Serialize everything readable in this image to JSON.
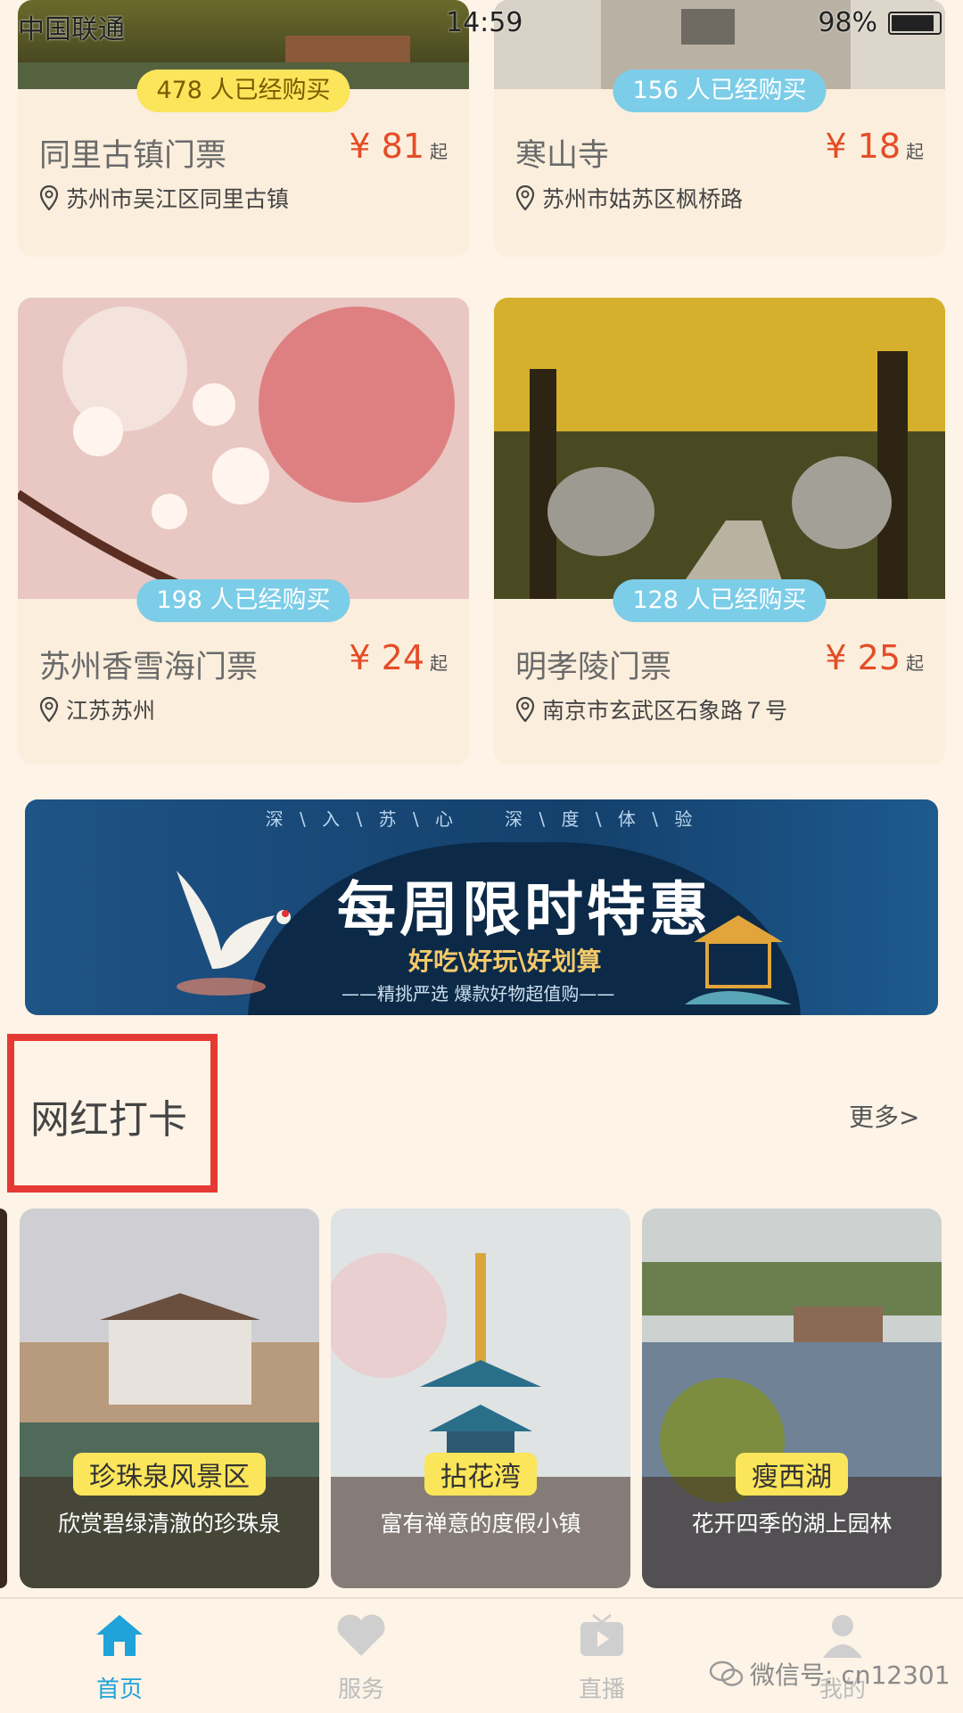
{
  "status_bar": {
    "carrier": "中国联通",
    "time": "14:59",
    "battery": "98%",
    "battery_fraction": 0.98
  },
  "tickets": [
    {
      "badge": "478 人已经购买",
      "title": "同里古镇门票",
      "price": "¥ 81",
      "suffix": "起",
      "location": "苏州市吴江区同里古镇"
    },
    {
      "badge": "156 人已经购买",
      "title": "寒山寺",
      "price": "¥ 18",
      "suffix": "起",
      "location": "苏州市姑苏区枫桥路"
    },
    {
      "badge": "198 人已经购买",
      "title": "苏州香雪海门票",
      "price": "¥ 24",
      "suffix": "起",
      "location": "江苏苏州"
    },
    {
      "badge": "128 人已经购买",
      "title": "明孝陵门票",
      "price": "¥ 25",
      "suffix": "起",
      "location": "南京市玄武区石象路７号"
    }
  ],
  "banner": {
    "top_text": "深 \\ 入 \\ 苏 \\ 心　　深 \\ 度 \\ 体 \\ 验",
    "headline": "每周限时特惠",
    "sub": "好吃\\好玩\\好划算",
    "slogan": "——精挑严选 爆款好物超值购——"
  },
  "section": {
    "title": "网红打卡",
    "more": "更多>"
  },
  "scenic": [
    {
      "tag": "珍珠泉风景区",
      "desc": "欣赏碧绿清澈的珍珠泉"
    },
    {
      "tag": "拈花湾",
      "desc": "富有禅意的度假小镇"
    },
    {
      "tag": "瘦西湖",
      "desc": "花开四季的湖上园林"
    }
  ],
  "tabs": [
    {
      "label": "首页",
      "icon": "home-icon"
    },
    {
      "label": "服务",
      "icon": "heart-icon"
    },
    {
      "label": "直播",
      "icon": "tv-play-icon"
    },
    {
      "label": "我的",
      "icon": "person-icon"
    }
  ],
  "watermark": "微信号: cn12301",
  "colors": {
    "accent": "#1fa3d8",
    "price": "#e44d26",
    "highlight": "#e53a33",
    "badge_yellow": "#fbe55a",
    "badge_blue": "#7ccde8"
  }
}
